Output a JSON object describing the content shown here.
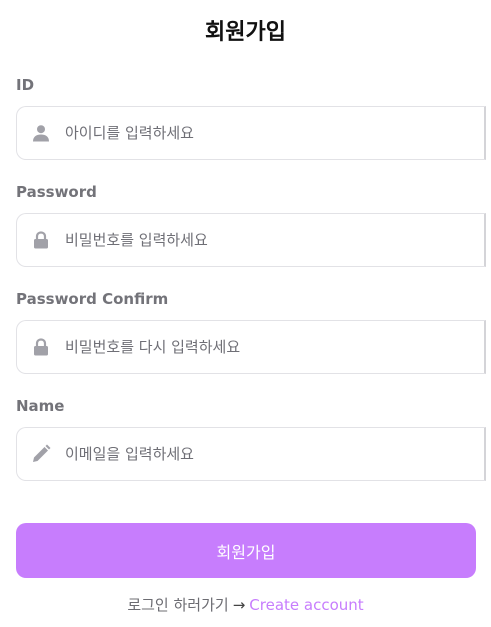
{
  "page": {
    "title": "회원가입"
  },
  "fields": [
    {
      "label": "ID",
      "placeholder": "아이디를 입력하세요",
      "value": "",
      "icon": "user-icon"
    },
    {
      "label": "Password",
      "placeholder": "비밀번호를 입력하세요",
      "value": "",
      "icon": "lock-icon"
    },
    {
      "label": "Password Confirm",
      "placeholder": "비밀번호를 다시 입력하세요",
      "value": "",
      "icon": "lock-icon"
    },
    {
      "label": "Name",
      "placeholder": "이메일을 입력하세요",
      "value": "",
      "icon": "pencil-icon"
    }
  ],
  "submit": {
    "label": "회원가입"
  },
  "footer": {
    "text": "로그인 하러가기",
    "arrow": "→",
    "link": "Create account"
  },
  "colors": {
    "accent": "#c77dfd",
    "label": "#737379",
    "icon": "#a1a1a8"
  }
}
